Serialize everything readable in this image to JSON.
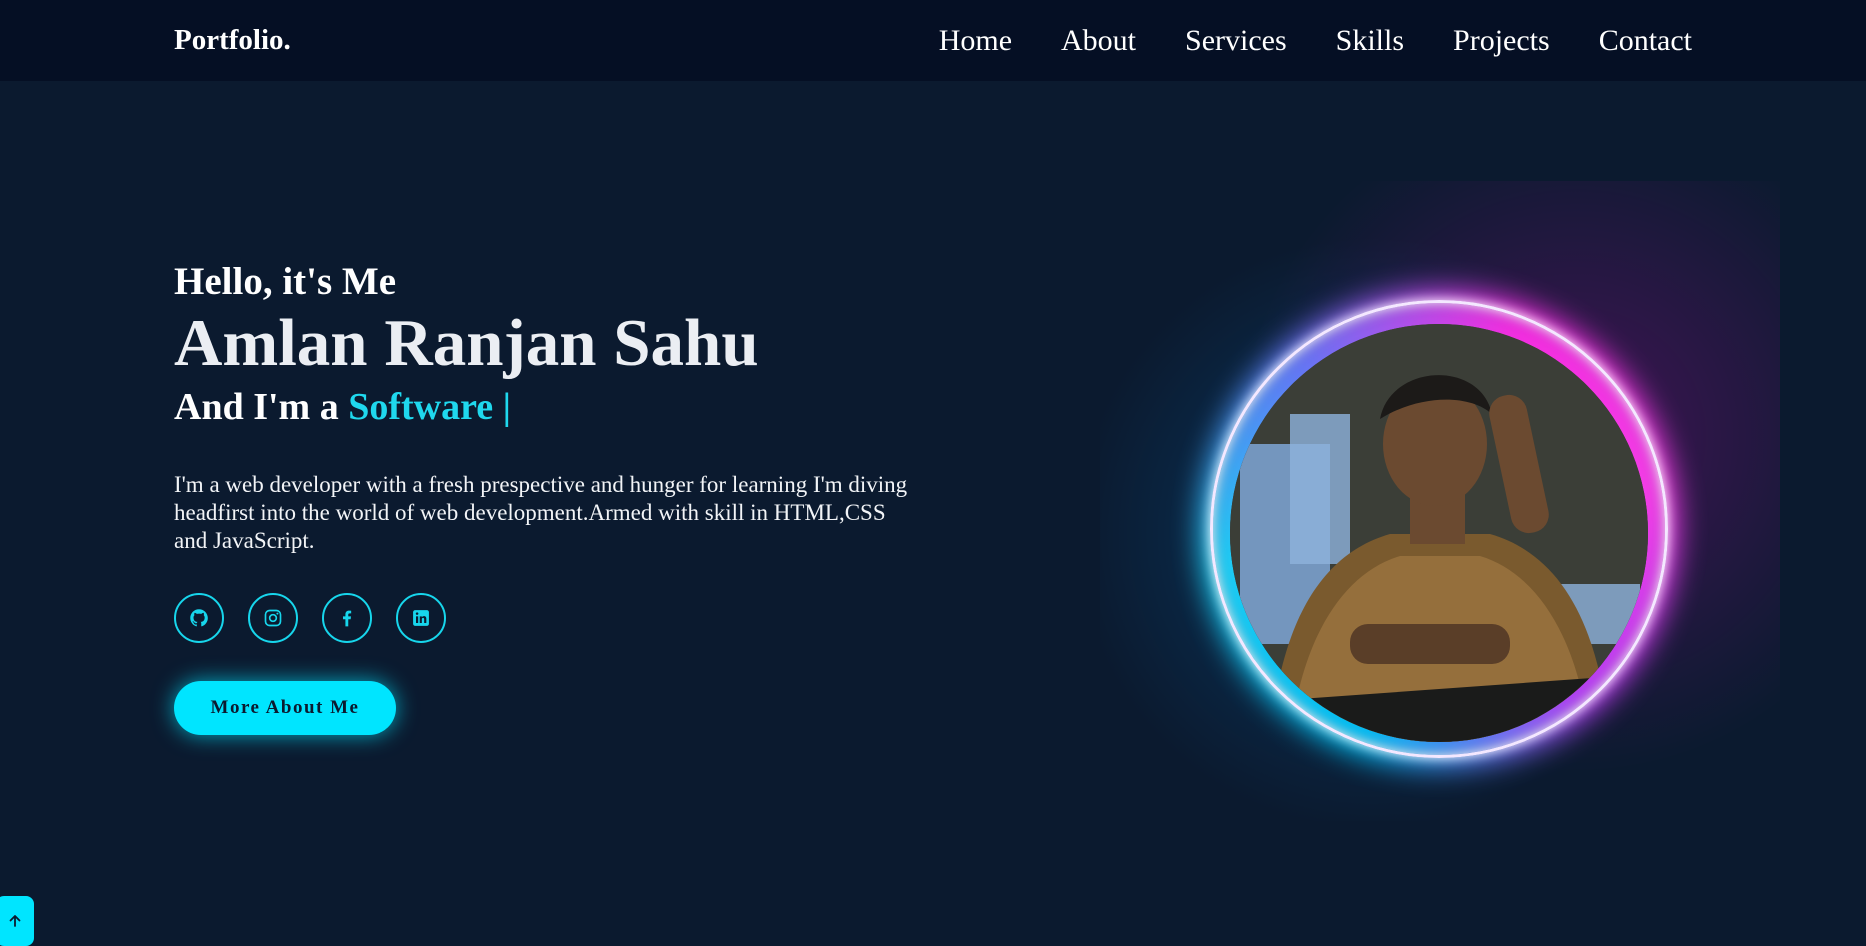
{
  "nav": {
    "logo": "Portfolio.",
    "links": [
      "Home",
      "About",
      "Services",
      "Skills",
      "Projects",
      "Contact"
    ]
  },
  "hero": {
    "greeting": "Hello, it's Me",
    "name": "Amlan Ranjan Sahu",
    "role_prefix": "And I'm a",
    "role_highlight": "Software |",
    "description": "I'm a web developer with a fresh prespective and hunger for learning I'm diving headfirst into the world of web development.Armed with skill in HTML,CSS and JavaScript.",
    "socials": [
      "github-icon",
      "instagram-icon",
      "facebook-icon",
      "linkedin-icon"
    ],
    "cta_label": "More About Me"
  },
  "colors": {
    "accent": "#00e5ff",
    "background": "#0b1a2f",
    "navbar": "#050f24",
    "ring_blue": "#00c8ff",
    "ring_pink": "#ff2ee8"
  },
  "scroll_top": {
    "icon": "arrow-up-icon"
  }
}
